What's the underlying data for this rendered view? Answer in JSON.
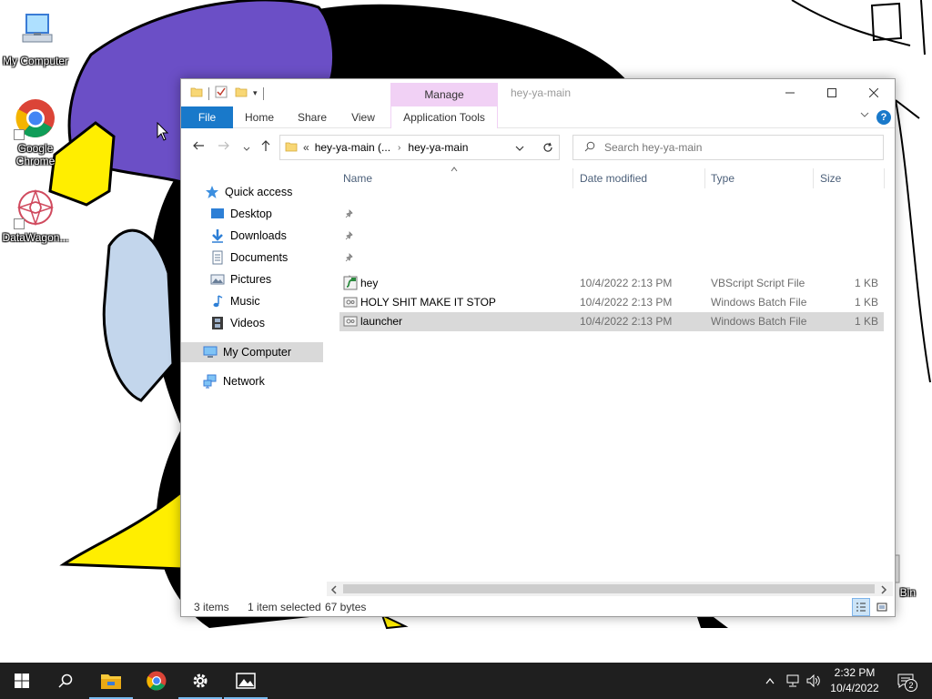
{
  "desktop": {
    "icons": [
      {
        "label": "My Computer"
      },
      {
        "label": "Google Chrome"
      },
      {
        "label": "DataWagon..."
      },
      {
        "label": "Bin"
      }
    ]
  },
  "window": {
    "title": "hey-ya-main",
    "contextual_tab": "Manage",
    "ribbon_tabs": [
      "File",
      "Home",
      "Share",
      "View",
      "Application Tools"
    ],
    "address": {
      "overflow": "«",
      "crumbs": [
        "hey-ya-main (...",
        "hey-ya-main"
      ]
    },
    "search_placeholder": "Search hey-ya-main",
    "nav": {
      "quick_access": "Quick access",
      "items": [
        {
          "label": "Desktop",
          "pinned": true
        },
        {
          "label": "Downloads",
          "pinned": true
        },
        {
          "label": "Documents",
          "pinned": true
        },
        {
          "label": "Pictures",
          "pinned": true
        },
        {
          "label": "Music",
          "pinned": false
        },
        {
          "label": "Videos",
          "pinned": false
        }
      ],
      "my_computer": "My Computer",
      "network": "Network"
    },
    "columns": {
      "name": "Name",
      "date": "Date modified",
      "type": "Type",
      "size": "Size"
    },
    "files": [
      {
        "name": "hey",
        "date": "10/4/2022 2:13 PM",
        "type": "VBScript Script File",
        "size": "1 KB",
        "icon": "vbscript-file-icon",
        "selected": false
      },
      {
        "name": "HOLY SHIT MAKE IT STOP",
        "date": "10/4/2022 2:13 PM",
        "type": "Windows Batch File",
        "size": "1 KB",
        "icon": "batch-file-icon",
        "selected": false
      },
      {
        "name": "launcher",
        "date": "10/4/2022 2:13 PM",
        "type": "Windows Batch File",
        "size": "1 KB",
        "icon": "batch-file-icon",
        "selected": true
      }
    ],
    "status": {
      "count": "3 items",
      "selected": "1 item selected",
      "bytes": "67 bytes"
    }
  },
  "taskbar": {
    "clock_time": "2:32 PM",
    "clock_date": "10/4/2022",
    "notification_count": "2"
  },
  "colors": {
    "file_tab": "#1979ca",
    "manage_tab": "#f1d1f5",
    "taskbar": "#1f1f1f",
    "selection": "#d9d9d9"
  }
}
